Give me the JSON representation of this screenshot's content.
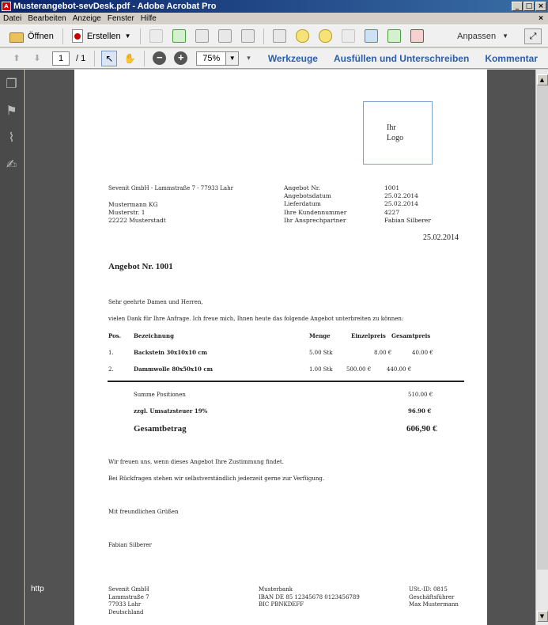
{
  "window": {
    "title": "Musterangebot-sevDesk.pdf - Adobe Acrobat Pro",
    "minimize": "_",
    "maximize": "□",
    "close": "×"
  },
  "menu": {
    "items": [
      "Datei",
      "Bearbeiten",
      "Anzeige",
      "Fenster",
      "Hilfe"
    ],
    "close": "×"
  },
  "toolbar": {
    "open_label": "Öffnen",
    "create_label": "Erstellen",
    "customize_label": "Anpassen"
  },
  "nav": {
    "page_current": "1",
    "page_total": "/ 1",
    "zoom": "75%",
    "links": [
      "Werkzeuge",
      "Ausfüllen und Unterschreiben",
      "Kommentar"
    ]
  },
  "status": {
    "http": "http"
  },
  "document": {
    "logo": [
      "Ihr",
      "Logo"
    ],
    "sender_line": "Sevenit GmbH - Lammstraße 7 - 77933 Lahr",
    "recipient": [
      "Mustermann KG",
      "Musterstr. 1",
      "22222 Musterstadt"
    ],
    "info_labels": [
      "Angebot Nr.",
      "Angebotsdatum",
      "Lieferdatum",
      "Ihre Kundennummer",
      "Ihr Ansprechpartner"
    ],
    "info_values": [
      "1001",
      "25.02.2014",
      "25.02.2014",
      "4227",
      "Fabian Silberer"
    ],
    "date": "25.02.2014",
    "heading": "Angebot Nr. 1001",
    "greeting": "Sehr geehrte Damen und Herren,",
    "intro": "vielen Dank für Ihre Anfrage. Ich freue mich, Ihnen heute das folgende Angebot unterbreiten zu können:",
    "table_headers": [
      "Pos.",
      "Bezeichnung",
      "Menge",
      "Einzelpreis",
      "Gesamtpreis"
    ],
    "rows": [
      {
        "pos": "1.",
        "name": "Backstein 30x10x10 cm",
        "qty": "5.00 Stk",
        "unit": "8.00 €",
        "total": "40.00 €"
      },
      {
        "pos": "2.",
        "name": "Dammwolle 80x50x10 cm",
        "qty": "1.00 Stk",
        "unit": "500.00 €",
        "total": "440.00 €"
      }
    ],
    "sum_label": "Summe Positionen",
    "sum_value": "510.00 €",
    "tax_label": "zzgl. Umsatzsteuer 19%",
    "tax_value": "96.90 €",
    "grand_label": "Gesamtbetrag",
    "grand_value": "606,90 €",
    "closing1": "Wir freuen uns, wenn dieses Angebot Ihre Zustimmung findet.",
    "closing2": "Bei Rückfragen stehen wir selbstverständlich jederzeit gerne zur Verfügung.",
    "regards": "Mit freundlichen Grüßen",
    "signature": "Fabian Silberer",
    "footer_col1": [
      "Sevenit GmbH",
      "Lammstraße 7",
      "77933 Lahr",
      "Deutschland"
    ],
    "footer_col2": [
      "Musterbank",
      "IBAN DE 85 12345678 0123456789",
      "BIC PBNKDEFF"
    ],
    "footer_col3": [
      "USt.-ID: 0815",
      "Geschäftsführer",
      "Max Mustermann"
    ]
  }
}
